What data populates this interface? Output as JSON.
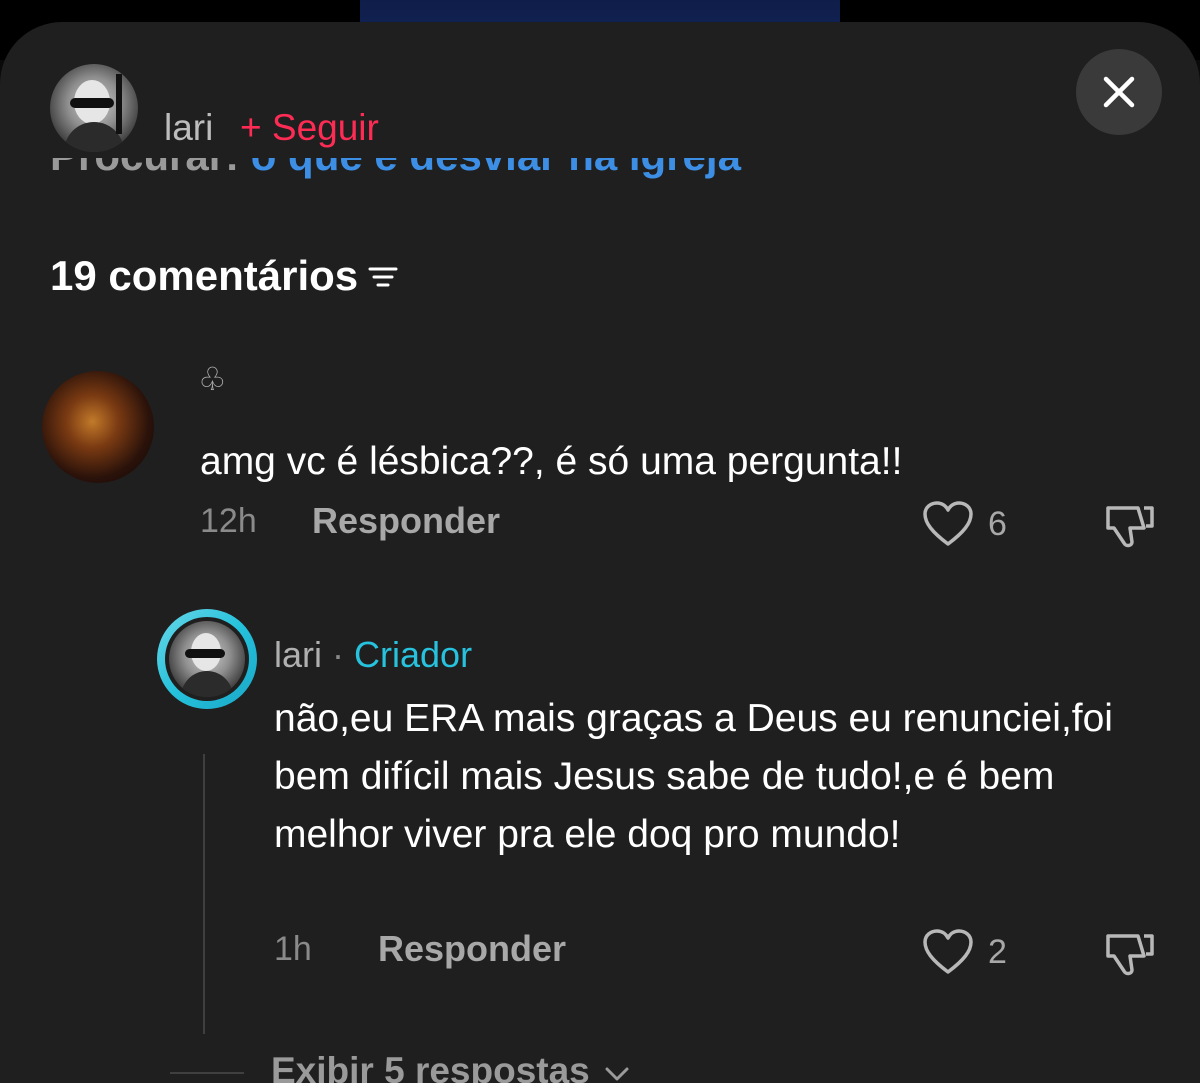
{
  "header": {
    "username": "lari",
    "follow_label": "+ Seguir"
  },
  "search": {
    "prefix": "Procurar: ",
    "query": "o que é desviar na igreja"
  },
  "comments_count": "19 comentários",
  "comment": {
    "username": "♧",
    "text": "amg vc é lésbica??, é só uma pergunta!!",
    "time": "12h",
    "reply_label": "Responder",
    "likes": "6"
  },
  "reply": {
    "username": "lari",
    "separator": " · ",
    "badge": "Criador",
    "text": "não,eu ERA mais graças a Deus eu renunciei,foi bem difícil mais Jesus sabe de tudo!,e é bem melhor viver pra ele doq pro mundo!",
    "time": "1h",
    "reply_label": "Responder",
    "likes": "2"
  },
  "view_replies": "Exibir 5 respostas",
  "colors": {
    "follow": "#fe2c55",
    "creator_badge": "#27c2dd",
    "search_query": "#3d8fe6",
    "sheet_bg": "#1f1f1f"
  },
  "icons": [
    "close-icon",
    "filter-icon",
    "heart-icon",
    "dislike-icon",
    "chevron-down-icon"
  ]
}
